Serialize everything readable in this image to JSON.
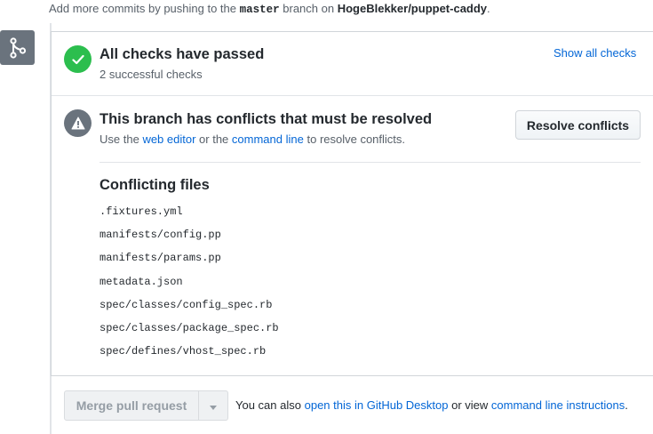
{
  "header_note": {
    "prefix": "Add more commits by pushing to the",
    "branch": "master",
    "middle": "branch on",
    "repo": "HogeBlekker/puppet-caddy",
    "suffix": "."
  },
  "icons": {
    "merge": "git-merge-icon",
    "check": "check-icon",
    "alert": "alert-icon",
    "caret": "triangle-down-icon"
  },
  "colors": {
    "success": "#2cbe4e",
    "neutral": "#6a737d",
    "link": "#0366d6"
  },
  "checks": {
    "title": "All checks have passed",
    "subtitle": "2 successful checks",
    "show_all": "Show all checks"
  },
  "conflicts": {
    "title": "This branch has conflicts that must be resolved",
    "sub_prefix": "Use the",
    "web_editor": "web editor",
    "sub_middle": "or the",
    "command_line": "command line",
    "sub_suffix": "to resolve conflicts.",
    "resolve_button": "Resolve conflicts",
    "files_title": "Conflicting files",
    "files": [
      ".fixtures.yml",
      "manifests/config.pp",
      "manifests/params.pp",
      "metadata.json",
      "spec/classes/config_spec.rb",
      "spec/classes/package_spec.rb",
      "spec/defines/vhost_spec.rb"
    ]
  },
  "merge": {
    "button": "Merge pull request",
    "hint_prefix": "You can also",
    "desktop_link": "open this in GitHub Desktop",
    "hint_middle": "or view",
    "cli_link": "command line instructions",
    "hint_suffix": "."
  }
}
